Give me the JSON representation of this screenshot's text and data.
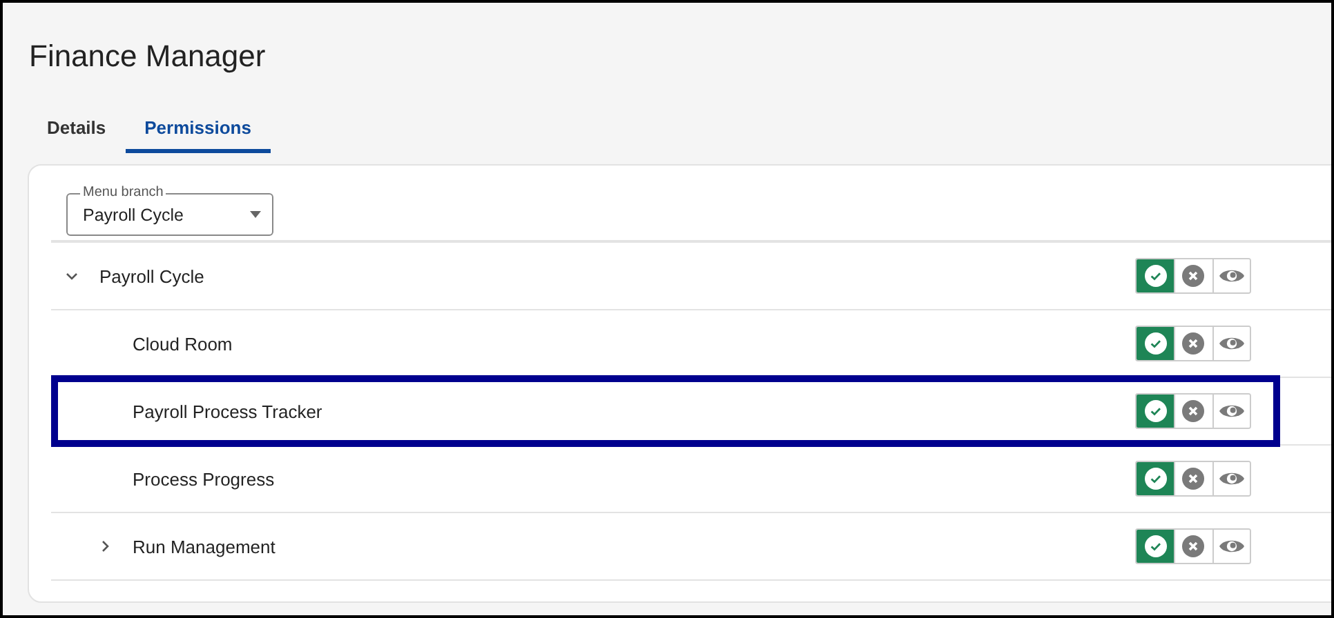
{
  "page": {
    "title": "Finance Manager"
  },
  "tabs": [
    {
      "label": "Details",
      "selected": false
    },
    {
      "label": "Permissions",
      "selected": true
    }
  ],
  "menu_branch": {
    "label": "Menu branch",
    "value": "Payroll Cycle"
  },
  "tree": [
    {
      "label": "Payroll Cycle",
      "expanded": true,
      "allow": true,
      "deny": false,
      "view": false,
      "highlighted": false,
      "children": [
        {
          "label": "Cloud Room",
          "allow": true,
          "deny": false,
          "view": false,
          "highlighted": false
        },
        {
          "label": "Payroll Process Tracker",
          "allow": true,
          "deny": false,
          "view": false,
          "highlighted": true
        },
        {
          "label": "Process Progress",
          "allow": true,
          "deny": false,
          "view": false,
          "highlighted": false
        },
        {
          "label": "Run Management",
          "expanded": false,
          "allow": true,
          "deny": false,
          "view": false,
          "highlighted": false
        }
      ]
    }
  ]
}
